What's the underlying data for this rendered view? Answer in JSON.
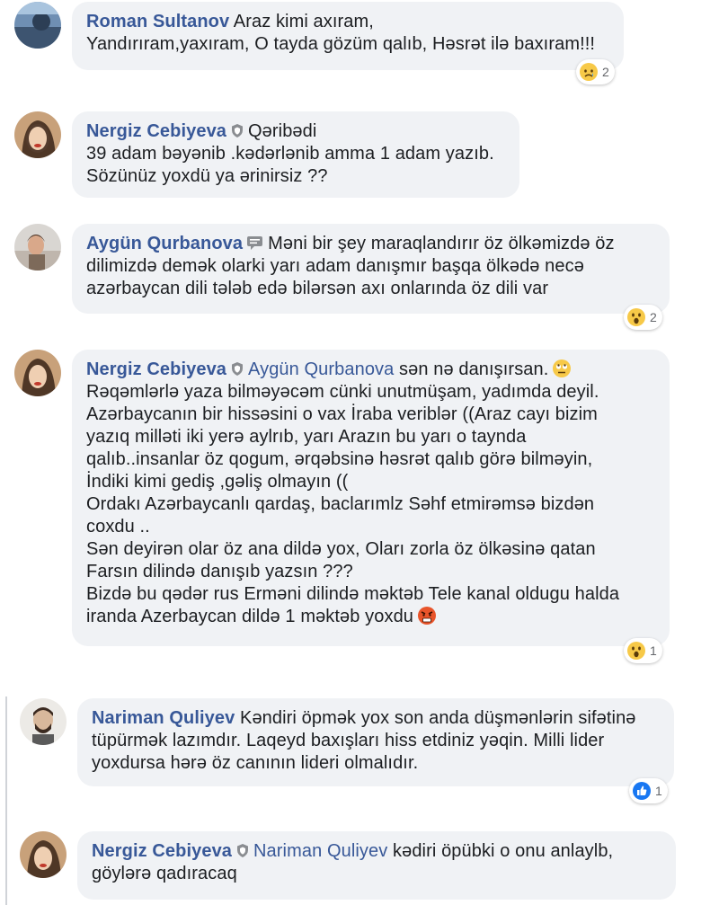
{
  "comments": [
    {
      "author": "Roman Sultanov",
      "lines": [
        "Araz kimi axıram,",
        "Yandırıram,yaxıram, O tayda gözüm qalıb, Həsrət ilə baxıram!!!"
      ],
      "reaction": {
        "icon": "crying-emoji-icon",
        "count": "2"
      }
    },
    {
      "author": "Nergiz Cebiyeva",
      "tag": "Qəribədi",
      "lines": [
        "39 adam bəyənib .kədərlənib amma 1 adam yazıb.",
        "Sözünüz yoxdü ya ərinirsiz ??"
      ]
    },
    {
      "author": "Aygün Qurbanova",
      "first_line": "Məni bir şey maraqlandırır öz ölkəmizdə öz",
      "lines": [
        "dilimizdə demək olarki yarı adam danışmır başqa ölkədə necə",
        "azərbaycan dili tələb edə bilərsən axı onlarında öz dili var"
      ],
      "reaction": {
        "icon": "wow-emoji-icon",
        "count": "2"
      }
    },
    {
      "author": "Nergiz Cebiyeva",
      "mention": "Aygün Qurbanova",
      "first_line": "sən nə danışırsan.",
      "lines": [
        "Rəqəmlərlə yaza bilməyəcəm cünki unutmüşam, yadımda deyil.",
        "Azərbaycanın bir hissəsini o vax İraba veriblər ((Araz cayı bizim",
        "yazıq milləti iki yerə aylrıb, yarı Arazın bu yarı o taynda",
        "qalıb..insanlar öz qogum, ərqəbsinə həsrət qalıb görə bilməyin,",
        "İndiki kimi gediş ,gəliş olmayın ((",
        "Ordakı Azərbaycanlı qardaş, baclarımlz Səhf etmirəmsə bizdən",
        "coxdu ..",
        "Sən deyirən olar öz ana dildə yox, Oları zorla öz ölkəsinə qatan",
        "Farsın dilində danışıb yazsın ???",
        "Bizdə bu qədər rus Ermәni dilində məktəb Tele kanal oldugu halda",
        "iranda Azerbaycan dildə 1 məktəb yoxdu"
      ],
      "reaction": {
        "icon": "wow-emoji-icon",
        "count": "1"
      }
    },
    {
      "author": "Nariman Quliyev",
      "first_line": "Kəndiri öpmək yox son anda düşmənlərin sifətinə",
      "lines": [
        "tüpürmək lazımdır. Laqeyd baxışları hiss etdiniz yəqin. Milli lider",
        "yoxdursa hərə öz canının lideri olmalıdır."
      ],
      "reaction": {
        "icon": "like-icon",
        "count": "1"
      }
    },
    {
      "author": "Nergiz Cebiyeva",
      "mention": "Nariman Quliyev",
      "first_line": "kədiri öpübki o onu anlaylb,",
      "lines": [
        "göylərə qadıracaq"
      ]
    }
  ],
  "colors": {
    "name": "#385898",
    "bubble": "#f0f2f5",
    "text": "#1c1e21"
  }
}
